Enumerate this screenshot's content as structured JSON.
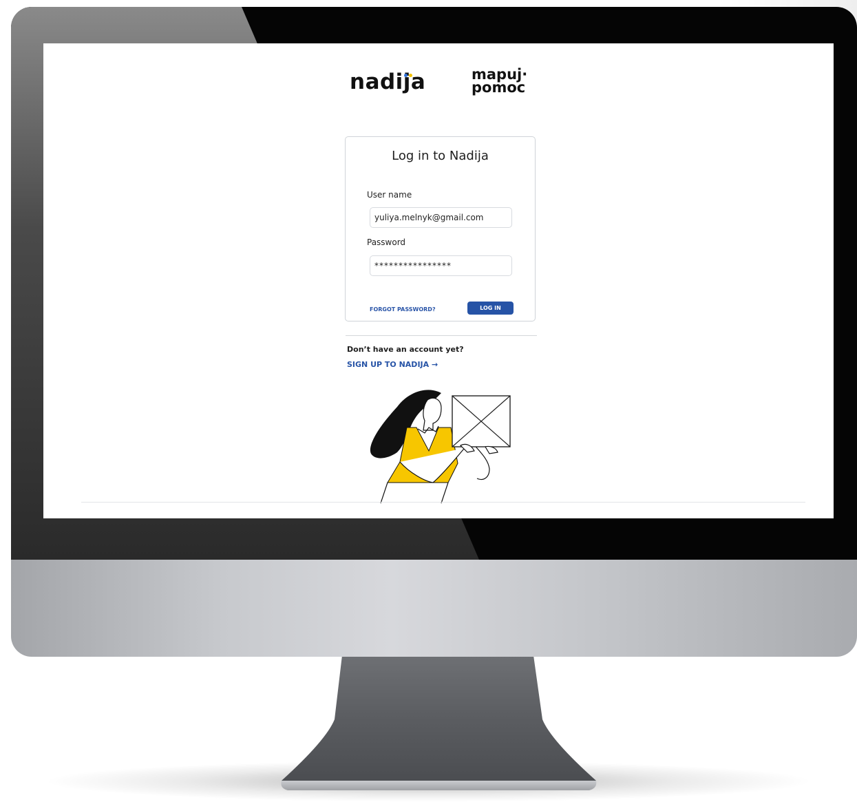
{
  "brand": {
    "logo_primary": "nadija",
    "logo_secondary_line1": "mapuj·",
    "logo_secondary_line2": "pomoc",
    "dot_colors": [
      "#2f6fd6",
      "#f5c400"
    ]
  },
  "login": {
    "title": "Log in to Nadija",
    "username_label": "User name",
    "username_value": "yuliya.melnyk@gmail.com",
    "password_label": "Password",
    "password_value": "****************",
    "forgot_label": "FORGOT PASSWORD?",
    "login_button": "LOG IN"
  },
  "signup": {
    "prompt": "Don’t have an account yet?",
    "link_label": "SIGN UP TO NADIJA  →"
  },
  "colors": {
    "accent": "#2653a6",
    "illustration_yellow": "#f7c600"
  }
}
